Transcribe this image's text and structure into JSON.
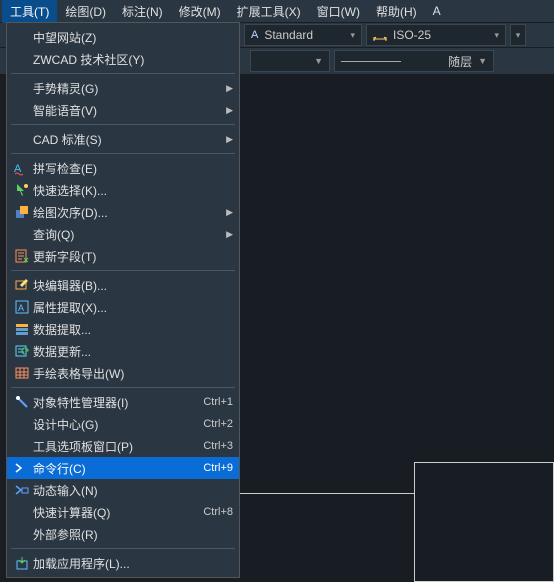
{
  "menubar": {
    "items": [
      {
        "label": "工具(T)",
        "active": true
      },
      {
        "label": "绘图(D)"
      },
      {
        "label": "标注(N)"
      },
      {
        "label": "修改(M)"
      },
      {
        "label": "扩展工具(X)"
      },
      {
        "label": "窗口(W)"
      },
      {
        "label": "帮助(H)"
      },
      {
        "label": "A"
      }
    ]
  },
  "toolbar": {
    "style": "Standard",
    "dimstyle": "ISO-25"
  },
  "toolbar2": {
    "layer": "随层"
  },
  "menu": {
    "groups": [
      [
        {
          "label": "中望网站(Z)",
          "icon": ""
        },
        {
          "label": "ZWCAD 技术社区(Y)",
          "icon": ""
        }
      ],
      [
        {
          "label": "手势精灵(G)",
          "icon": "",
          "submenu": true
        },
        {
          "label": "智能语音(V)",
          "icon": "",
          "submenu": true
        }
      ],
      [
        {
          "label": "CAD 标准(S)",
          "icon": "",
          "submenu": true
        }
      ],
      [
        {
          "label": "拼写检查(E)",
          "icon": "spell"
        },
        {
          "label": "快速选择(K)...",
          "icon": "qselect"
        },
        {
          "label": "绘图次序(D)...",
          "icon": "order",
          "submenu": true
        },
        {
          "label": "查询(Q)",
          "icon": "",
          "submenu": true
        },
        {
          "label": "更新字段(T)",
          "icon": "field"
        }
      ],
      [
        {
          "label": "块编辑器(B)...",
          "icon": "bedit"
        },
        {
          "label": "属性提取(X)...",
          "icon": "attext"
        },
        {
          "label": "数据提取...",
          "icon": "dataext"
        },
        {
          "label": "数据更新...",
          "icon": "dataupd"
        },
        {
          "label": "手绘表格导出(W)",
          "icon": "table"
        }
      ],
      [
        {
          "label": "对象特性管理器(I)",
          "icon": "props",
          "shortcut": "Ctrl+1"
        },
        {
          "label": "设计中心(G)",
          "icon": "",
          "shortcut": "Ctrl+2"
        },
        {
          "label": "工具选项板窗口(P)",
          "icon": "",
          "shortcut": "Ctrl+3"
        },
        {
          "label": "命令行(C)",
          "icon": "cmdline",
          "shortcut": "Ctrl+9",
          "highlighted": true
        },
        {
          "label": "动态输入(N)",
          "icon": "dynin"
        },
        {
          "label": "快速计算器(Q)",
          "icon": "",
          "shortcut": "Ctrl+8"
        },
        {
          "label": "外部参照(R)",
          "icon": ""
        }
      ],
      [
        {
          "label": "加载应用程序(L)...",
          "icon": "appload"
        }
      ]
    ]
  }
}
